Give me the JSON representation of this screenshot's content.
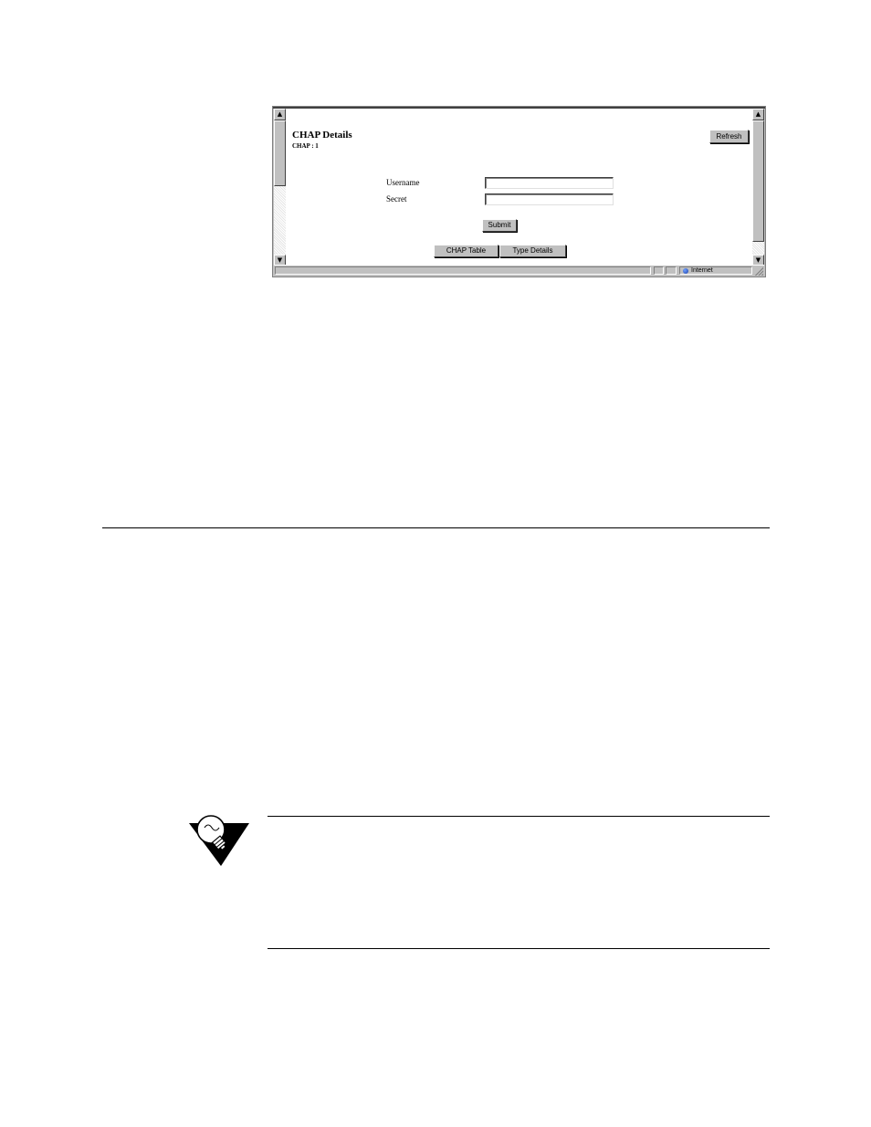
{
  "browser": {
    "page": {
      "title": "CHAP Details",
      "subtitle": "CHAP : 1",
      "refresh_label": "Refresh"
    },
    "form": {
      "username_label": "Username",
      "username_value": "",
      "secret_label": "Secret",
      "secret_value": "",
      "submit_label": "Submit"
    },
    "nav": {
      "chap_table_label": "CHAP Table",
      "type_details_label": "Type Details"
    },
    "statusbar": {
      "zone_label": "Internet",
      "zone_icon": "globe-icon"
    }
  },
  "note": {
    "icon": "lightbulb-icon"
  }
}
